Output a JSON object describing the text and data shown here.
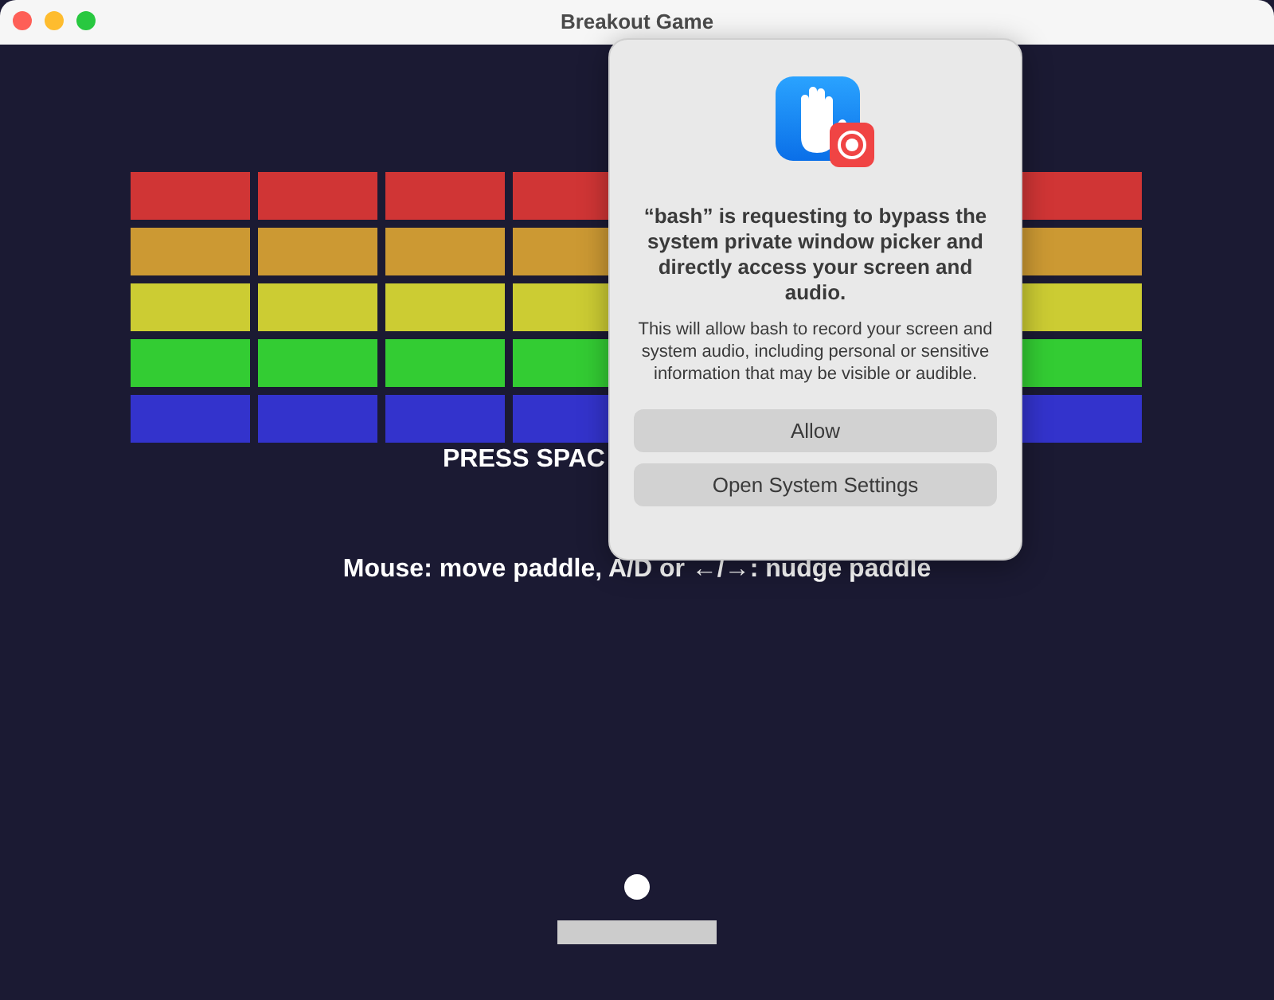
{
  "window": {
    "title": "Breakout Game"
  },
  "game": {
    "brick_rows": [
      {
        "color": "#d03535"
      },
      {
        "color": "#cc9933"
      },
      {
        "color": "#cccc33"
      },
      {
        "color": "#33cc33"
      },
      {
        "color": "#3333cc"
      }
    ],
    "prompt": "PRESS SPAC",
    "instructions": "Mouse: move paddle, A/D or ←/→: nudge paddle"
  },
  "dialog": {
    "title": "“bash” is requesting to bypass the system private window picker and directly access your screen and audio.",
    "message": "This will allow bash to record your screen and system audio, including personal or sensitive information that may be visible or audible.",
    "buttons": [
      "Allow",
      "Open System Settings"
    ]
  }
}
